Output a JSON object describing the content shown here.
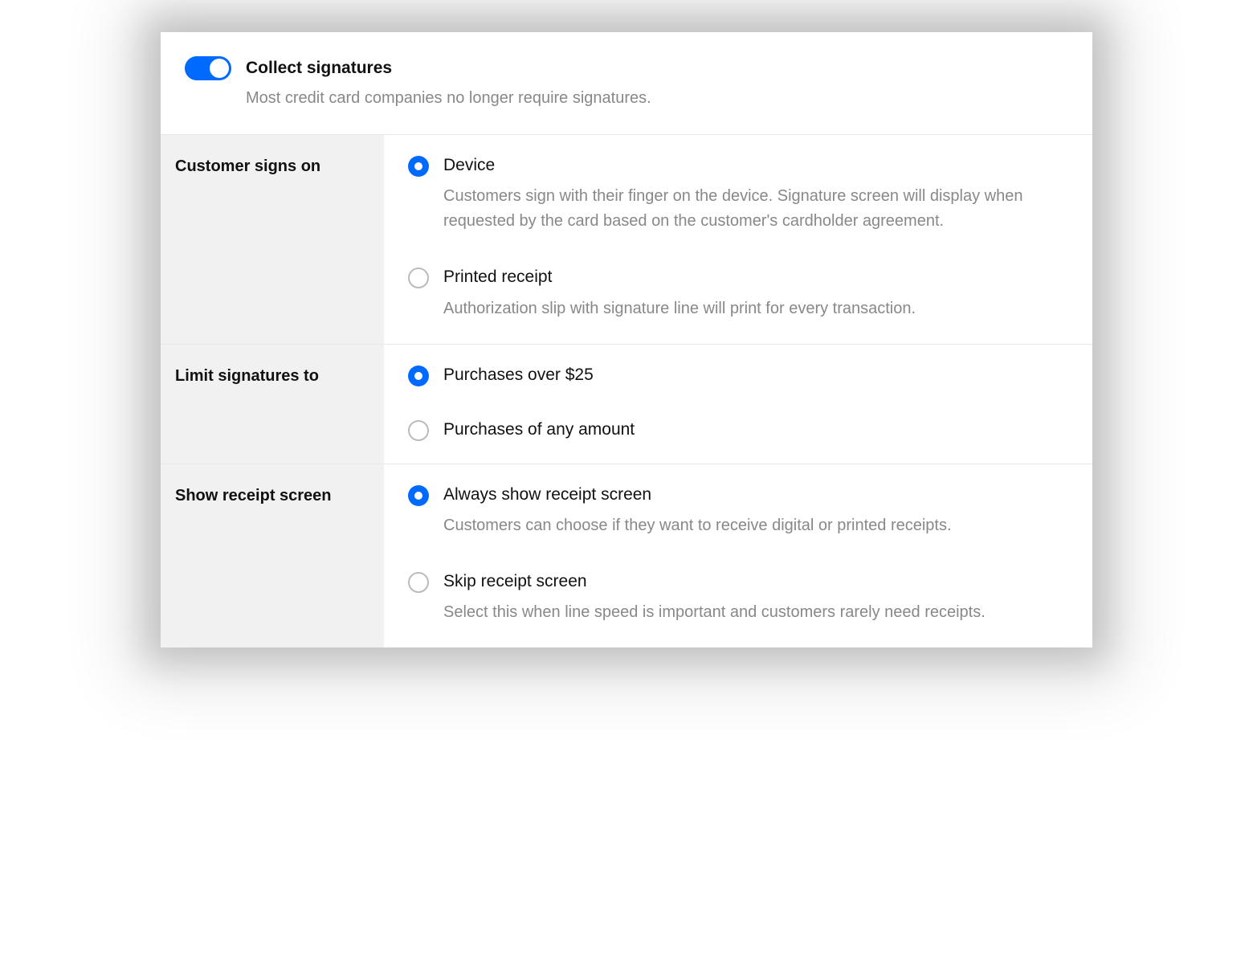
{
  "colors": {
    "accent": "#006aff"
  },
  "header": {
    "toggle_on": true,
    "title": "Collect signatures",
    "subtitle": "Most credit card companies no longer require signatures."
  },
  "sections": [
    {
      "label": "Customer signs on",
      "options": [
        {
          "selected": true,
          "title": "Device",
          "desc": "Customers sign with their finger on the device. Signature screen will display when requested by the card based on the customer's cardholder agreement."
        },
        {
          "selected": false,
          "title": "Printed receipt",
          "desc": "Authorization slip with signature line will print for every transaction."
        }
      ]
    },
    {
      "label": "Limit signatures to",
      "options": [
        {
          "selected": true,
          "title": "Purchases over $25"
        },
        {
          "selected": false,
          "title": "Purchases of any amount"
        }
      ]
    },
    {
      "label": "Show receipt screen",
      "options": [
        {
          "selected": true,
          "title": "Always show receipt screen",
          "desc": "Customers can choose if they want to receive digital or printed receipts."
        },
        {
          "selected": false,
          "title": "Skip receipt screen",
          "desc": "Select this when line speed is important and customers rarely need receipts."
        }
      ]
    }
  ]
}
